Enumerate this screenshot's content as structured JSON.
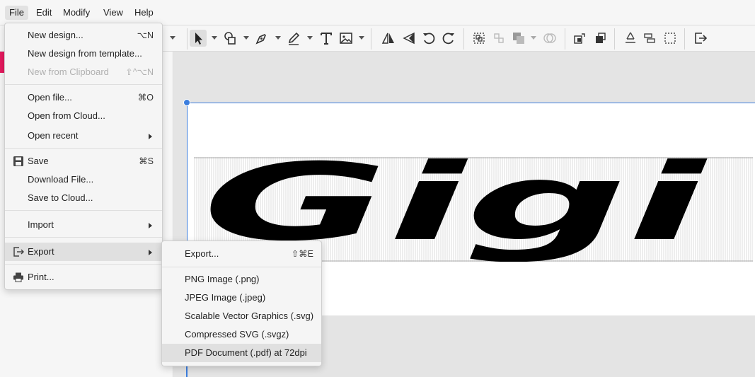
{
  "menubar": {
    "items": [
      "File",
      "Edit",
      "Modify",
      "View",
      "Help"
    ],
    "active": "File"
  },
  "canvas": {
    "artwork_text": "Gigi"
  },
  "file_menu": {
    "new_design": {
      "label": "New design...",
      "shortcut": "⌥N"
    },
    "new_from_template": {
      "label": "New design from template..."
    },
    "new_from_clipboard": {
      "label": "New from Clipboard",
      "shortcut": "⇧^⌥N"
    },
    "open_file": {
      "label": "Open file...",
      "shortcut": "⌘O"
    },
    "open_from_cloud": {
      "label": "Open from Cloud..."
    },
    "open_recent": {
      "label": "Open recent"
    },
    "save": {
      "label": "Save",
      "shortcut": "⌘S"
    },
    "download_file": {
      "label": "Download File..."
    },
    "save_to_cloud": {
      "label": "Save to Cloud..."
    },
    "import": {
      "label": "Import"
    },
    "export": {
      "label": "Export"
    },
    "print": {
      "label": "Print..."
    }
  },
  "export_menu": {
    "export": {
      "label": "Export...",
      "shortcut": "⇧⌘E"
    },
    "png": {
      "label": "PNG Image (.png)"
    },
    "jpeg": {
      "label": "JPEG Image (.jpeg)"
    },
    "svg": {
      "label": "Scalable Vector Graphics (.svg)"
    },
    "svgz": {
      "label": "Compressed SVG (.svgz)"
    },
    "pdf": {
      "label": "PDF Document (.pdf) at 72dpi"
    }
  },
  "colors": {
    "accent": "#3b7ddd",
    "brand": "#e5195e",
    "highlight": "#e0e0e0"
  }
}
